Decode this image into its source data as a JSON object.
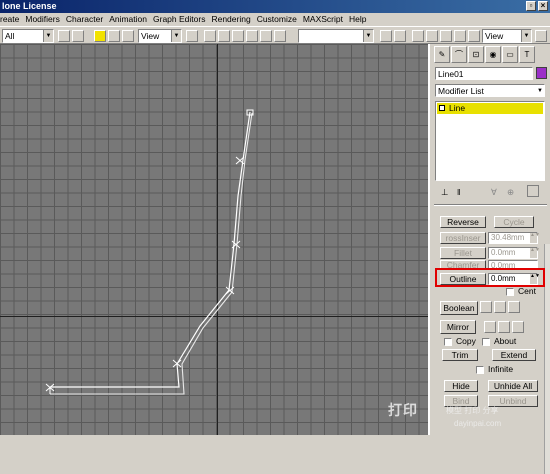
{
  "window": {
    "title": "lone License"
  },
  "menu": [
    "reate",
    "Modifiers",
    "Character",
    "Animation",
    "Graph Editors",
    "Rendering",
    "Customize",
    "MAXScript",
    "Help"
  ],
  "toolbar": {
    "selection_filter": "All",
    "ref_coord": "View",
    "named_selection": "",
    "view_combo_right": "View"
  },
  "panel": {
    "object_name": "Line01",
    "object_color": "#9b30c8",
    "modifier_list": "Modifier List",
    "stack_item": "Line",
    "buttons": {
      "reverse": "Reverse",
      "cycle": "Cycle",
      "cross_insert": "rossInser",
      "fillet": "Fillet",
      "chamfer": "Chamfer",
      "outline": "Outline",
      "boolean": "Boolean",
      "mirror": "Mirror",
      "trim": "Trim",
      "extend": "Extend",
      "hide": "Hide",
      "unhide_all": "Unhide All",
      "bind": "Bind",
      "unbind": "Unbind"
    },
    "spinners": {
      "cross_insert_val": "30.48mm",
      "fillet_val": "0.0mm",
      "chamfer_val": "0.0mm",
      "outline_val": "0.0mm"
    },
    "labels": {
      "center": "Cent",
      "copy": "Copy",
      "about": "About",
      "infinite": "Infinite"
    }
  },
  "watermark": {
    "main": "打印",
    "line1": "模型 打印 分享",
    "line2": "dayinpai.com"
  }
}
